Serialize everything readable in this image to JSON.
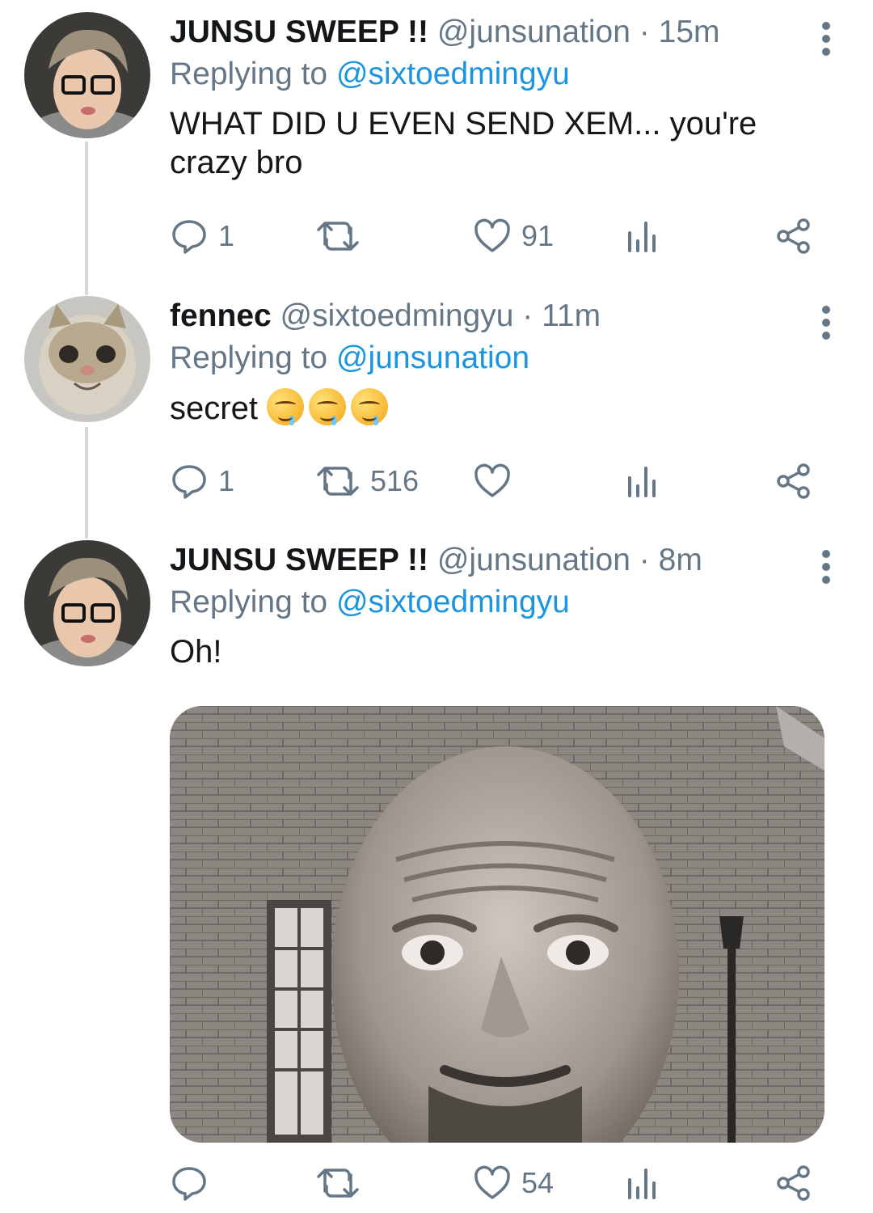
{
  "tweets": [
    {
      "name": "JUNSU SWEEP !!",
      "handle": "@junsunation",
      "time": "15m",
      "replying_prefix": "Replying to",
      "replying_to": "@sixtoedmingyu",
      "text": "WHAT DID U EVEN SEND XEM... you're crazy bro",
      "reply_count": "1",
      "retweet_count": "",
      "like_count": "91"
    },
    {
      "name": "fennec",
      "handle": "@sixtoedmingyu",
      "time": "11m",
      "replying_prefix": "Replying to",
      "replying_to": "@junsunation",
      "text": "secret",
      "emoji": [
        "drooling-face",
        "drooling-face",
        "drooling-face"
      ],
      "reply_count": "1",
      "retweet_count": "516",
      "like_count": ""
    },
    {
      "name": "JUNSU SWEEP !!",
      "handle": "@junsunation",
      "time": "8m",
      "replying_prefix": "Replying to",
      "replying_to": "@sixtoedmingyu",
      "text": "Oh!",
      "reply_count": "",
      "retweet_count": "",
      "like_count": "54"
    }
  ],
  "icons": {
    "reply": "reply-icon",
    "retweet": "retweet-icon",
    "like": "heart-icon",
    "analytics": "analytics-icon",
    "share": "share-icon",
    "more": "more-vertical-icon"
  },
  "colors": {
    "text": "#14171a",
    "secondary": "#657786",
    "link": "#1b95e0",
    "thread_line": "#d6d9db"
  }
}
